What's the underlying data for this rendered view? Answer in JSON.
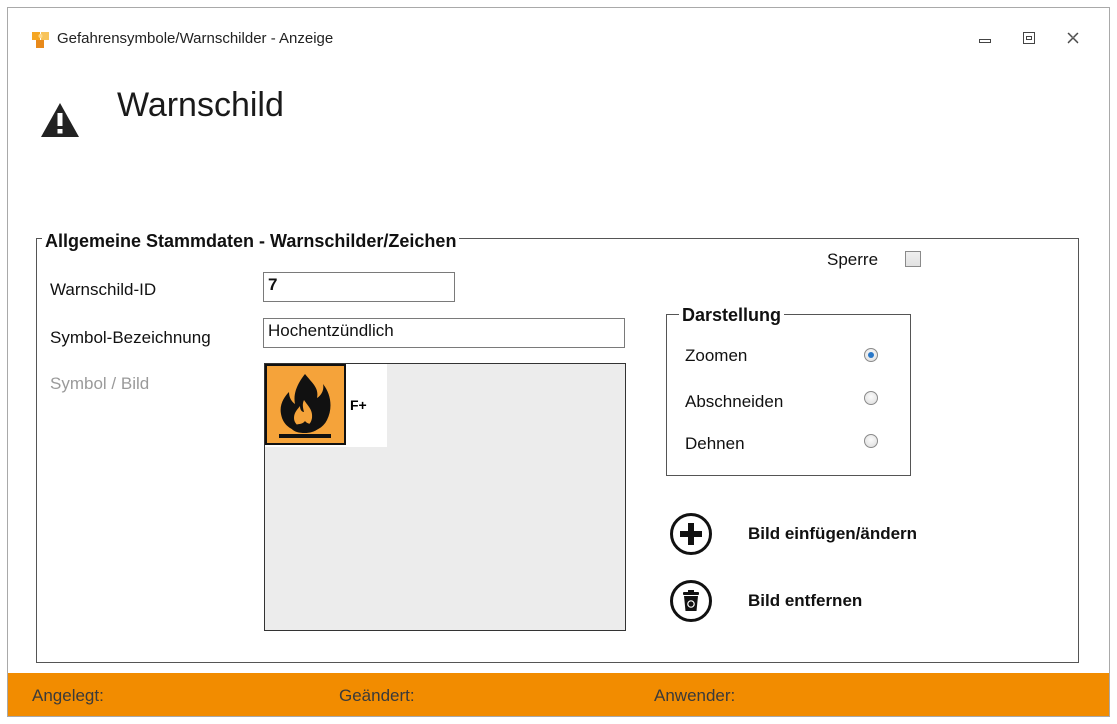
{
  "window": {
    "title": "Gefahrensymbole/Warnschilder - Anzeige",
    "icon": "app-puzzle-icon",
    "controls": [
      "minimize",
      "maximize",
      "close"
    ]
  },
  "header": {
    "title": "Warnschild",
    "icon": "warning-triangle-icon"
  },
  "group": {
    "legend": "Allgemeine Stammdaten - Warnschilder/Zeichen",
    "sperre_label": "Sperre",
    "sperre_checked": false,
    "fields": {
      "id_label": "Warnschild-ID",
      "id_value": "7",
      "bez_label": "Symbol-Bezeichnung",
      "bez_value": "Hochentzündlich",
      "bild_label": "Symbol / Bild"
    },
    "symbol": {
      "icon": "flame-icon",
      "code": "F+"
    },
    "darstellung": {
      "legend": "Darstellung",
      "options": [
        {
          "label": "Zoomen",
          "checked": true
        },
        {
          "label": "Abschneiden",
          "checked": false
        },
        {
          "label": "Dehnen",
          "checked": false
        }
      ]
    },
    "actions": {
      "add_label": "Bild einfügen/ändern",
      "remove_label": "Bild entfernen"
    }
  },
  "statusbar": {
    "angelegt": "Angelegt:",
    "geaendert": "Geändert:",
    "anwender": "Anwender:"
  },
  "colors": {
    "statusbar": "#f28c00",
    "symbol_background": "#f5a33a",
    "radio_selected": "#2a78c8"
  }
}
